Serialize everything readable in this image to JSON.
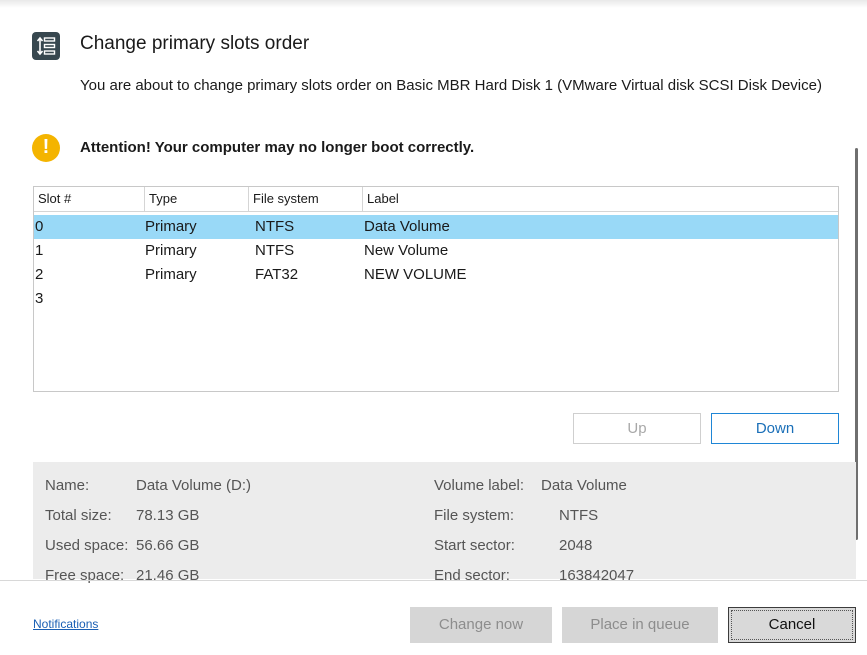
{
  "dialog": {
    "title": "Change primary slots order",
    "subtitle": "You are about to change primary slots order on Basic MBR Hard Disk 1 (VMware Virtual disk SCSI Disk Device)",
    "warning": "Attention! Your computer may no longer boot correctly.",
    "title_icon": "slots-order-icon",
    "warning_icon": "exclamation-icon"
  },
  "table": {
    "headers": [
      "Slot #",
      "Type",
      "File system",
      "Label"
    ],
    "rows": [
      {
        "slot": "0",
        "type": "Primary",
        "fs": "NTFS",
        "label": "Data Volume"
      },
      {
        "slot": "1",
        "type": "Primary",
        "fs": "NTFS",
        "label": "New Volume"
      },
      {
        "slot": "2",
        "type": "Primary",
        "fs": "FAT32",
        "label": "NEW VOLUME"
      },
      {
        "slot": "3",
        "type": "",
        "fs": "",
        "label": ""
      }
    ],
    "selected_row": 0,
    "selected_color": "#99d9f7"
  },
  "buttons": {
    "up": "Up",
    "down": "Down",
    "change_now": "Change now",
    "place_in_queue": "Place in queue",
    "cancel": "Cancel"
  },
  "details": {
    "name_label": "Name:",
    "name_value": "Data Volume (D:)",
    "total_label": "Total size:",
    "total_value": "78.13 GB",
    "used_label": "Used space:",
    "used_value": "56.66 GB",
    "free_label": "Free space:",
    "free_value": "21.46 GB",
    "vlabel_label": "Volume label:",
    "vlabel_value": "Data Volume",
    "fs_label": "File system:",
    "fs_value": "NTFS",
    "start_label": "Start sector:",
    "start_value": "2048",
    "end_label": "End sector:",
    "end_value": "163842047"
  },
  "footer": {
    "notifications": "Notifications"
  },
  "colors": {
    "accent": "#1f86d6",
    "warning": "#f4b400"
  }
}
